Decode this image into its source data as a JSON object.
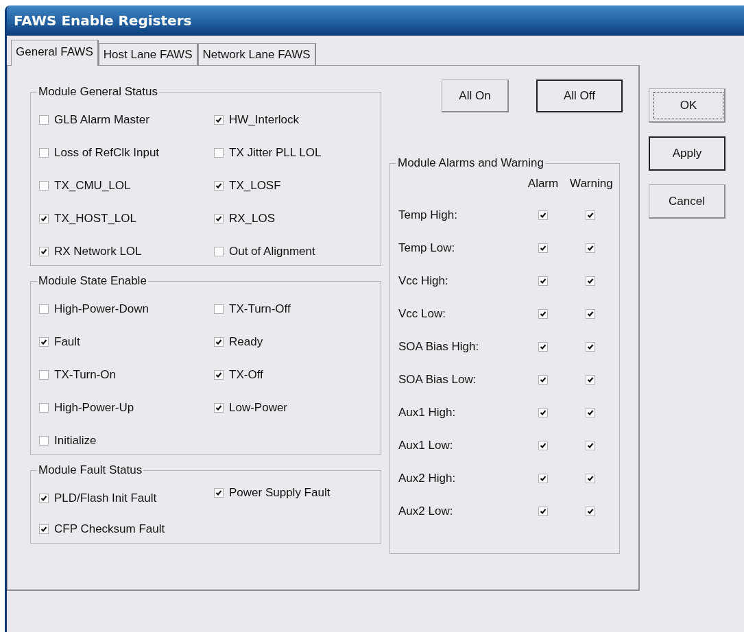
{
  "window": {
    "title": "FAWS Enable Registers"
  },
  "tabs": [
    {
      "label": "General FAWS",
      "selected": true
    },
    {
      "label": "Host Lane FAWS",
      "selected": false
    },
    {
      "label": "Network Lane FAWS",
      "selected": false
    }
  ],
  "groups": [
    {
      "title": "Module General Status",
      "items": [
        {
          "label": "GLB Alarm Master",
          "checked": false
        },
        {
          "label": "HW_Interlock",
          "checked": true
        },
        {
          "label": "Loss of RefClk Input",
          "checked": false
        },
        {
          "label": "TX Jitter PLL LOL",
          "checked": false
        },
        {
          "label": "TX_CMU_LOL",
          "checked": false
        },
        {
          "label": "TX_LOSF",
          "checked": true
        },
        {
          "label": "TX_HOST_LOL",
          "checked": true
        },
        {
          "label": "RX_LOS",
          "checked": true
        },
        {
          "label": "RX Network LOL",
          "checked": true
        },
        {
          "label": "Out of Alignment",
          "checked": false
        }
      ]
    },
    {
      "title": "Module State Enable",
      "items": [
        {
          "label": "High-Power-Down",
          "checked": false
        },
        {
          "label": "TX-Turn-Off",
          "checked": false
        },
        {
          "label": "Fault",
          "checked": true
        },
        {
          "label": "Ready",
          "checked": true
        },
        {
          "label": "TX-Turn-On",
          "checked": false
        },
        {
          "label": "TX-Off",
          "checked": true
        },
        {
          "label": "High-Power-Up",
          "checked": false
        },
        {
          "label": "Low-Power",
          "checked": true
        },
        {
          "label": "Initialize",
          "checked": false
        }
      ]
    },
    {
      "title": "Module Fault Status",
      "items": [
        {
          "label": "PLD/Flash Init Fault",
          "checked": true
        },
        {
          "label": "Power Supply Fault",
          "checked": true
        },
        {
          "label": "CFP Checksum Fault",
          "checked": true
        }
      ]
    }
  ],
  "toggle_buttons": [
    {
      "label": "All On",
      "default": false
    },
    {
      "label": "All Off",
      "default": true
    }
  ],
  "alarms": {
    "title": "Module Alarms and Warning",
    "columns": [
      "Alarm",
      "Warning"
    ],
    "rows": [
      {
        "label": "Temp High:",
        "alarm": true,
        "warning": true
      },
      {
        "label": "Temp Low:",
        "alarm": true,
        "warning": true
      },
      {
        "label": "Vcc High:",
        "alarm": true,
        "warning": true
      },
      {
        "label": "Vcc Low:",
        "alarm": true,
        "warning": true
      },
      {
        "label": "SOA Bias High:",
        "alarm": true,
        "warning": true
      },
      {
        "label": "SOA Bias Low:",
        "alarm": true,
        "warning": true
      },
      {
        "label": "Aux1 High:",
        "alarm": true,
        "warning": true
      },
      {
        "label": "Aux1 Low:",
        "alarm": true,
        "warning": true
      },
      {
        "label": "Aux2 High:",
        "alarm": true,
        "warning": true
      },
      {
        "label": "Aux2 Low:",
        "alarm": true,
        "warning": true
      }
    ]
  },
  "buttons": [
    {
      "label": "OK",
      "focused": true,
      "default": false
    },
    {
      "label": "Apply",
      "focused": false,
      "default": true
    },
    {
      "label": "Cancel",
      "focused": false,
      "default": false
    }
  ]
}
